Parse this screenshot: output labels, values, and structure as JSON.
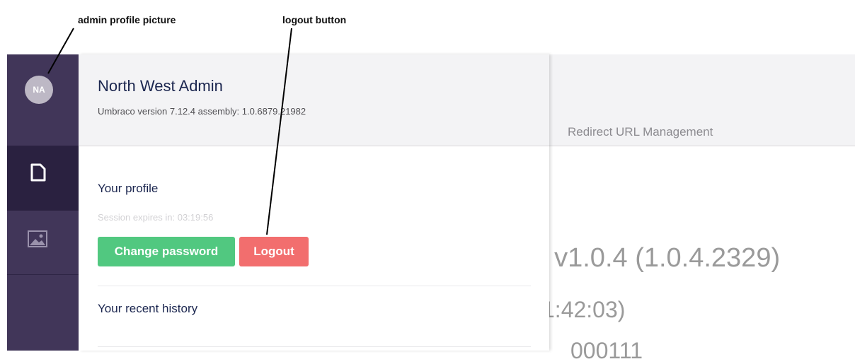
{
  "annotations": {
    "avatar_label": "admin profile picture",
    "logout_label": "logout button"
  },
  "sidebar": {
    "avatar_initials": "NA",
    "items": [
      {
        "icon": "document-icon"
      },
      {
        "icon": "image-icon"
      }
    ]
  },
  "background_page": {
    "tab_label": "Redirect URL Management",
    "version_text": ": v1.0.4 (1.0.4.2329)",
    "time_text": "1:42:03)",
    "extra_text": "000111"
  },
  "user_panel": {
    "name": "North West Admin",
    "version_info": "Umbraco version 7.12.4 assembly: 1.0.6879.21982",
    "profile_heading": "Your profile",
    "session_text": "Session expires in: 03:19:56",
    "change_password_label": "Change password",
    "logout_label": "Logout",
    "history_heading": "Your recent history"
  },
  "colors": {
    "sidebar": "#413659",
    "sidebar_active": "#2a2140",
    "change_password": "#51c880",
    "logout": "#f26e6e",
    "heading": "#1b264f"
  }
}
